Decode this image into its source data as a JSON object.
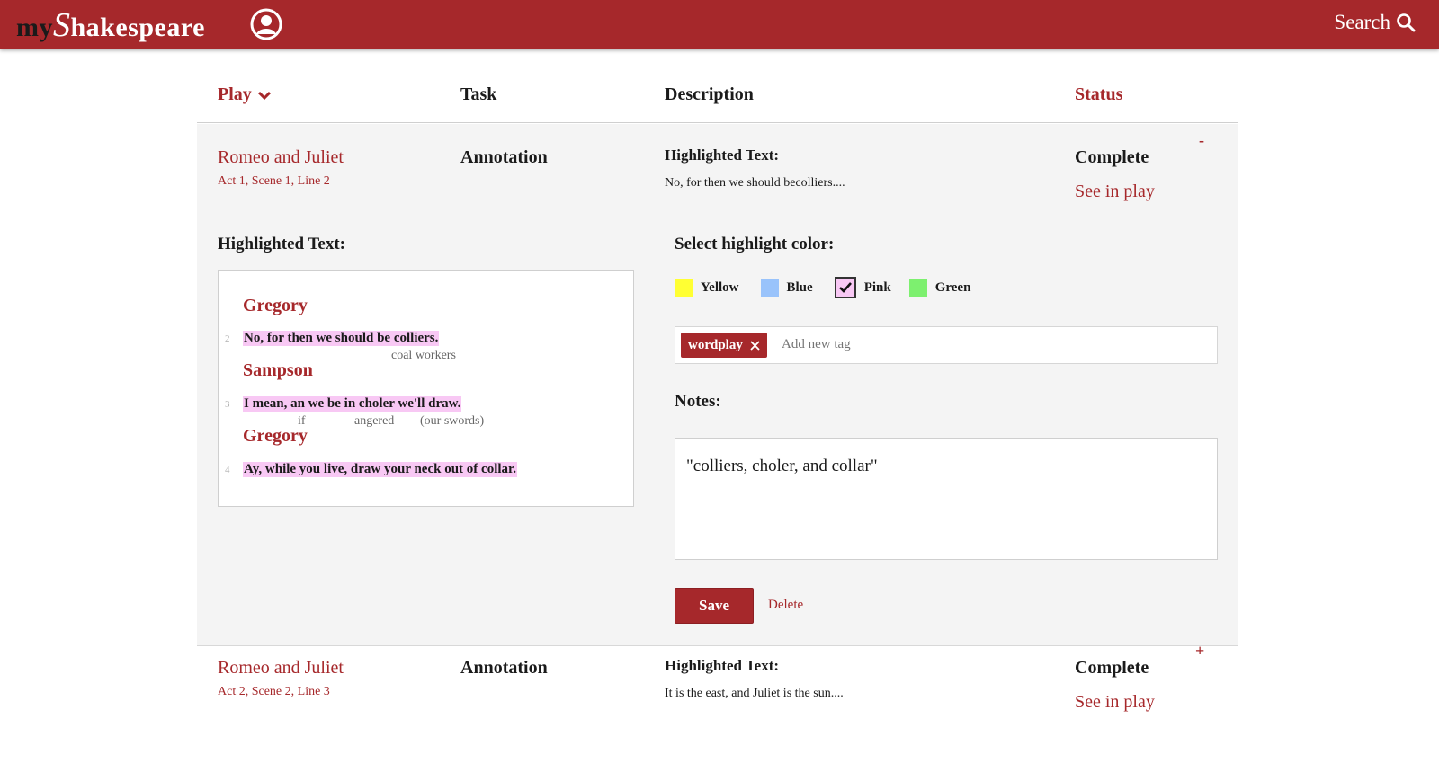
{
  "app": {
    "logo_prefix": "my",
    "logo_S": "S",
    "logo_rest": "hakespeare",
    "search_label": "Search"
  },
  "columns": {
    "play": "Play",
    "task": "Task",
    "description": "Description",
    "status": "Status"
  },
  "rows": [
    {
      "play": "Romeo and Juliet",
      "location": "Act 1, Scene 1, Line 2",
      "task": "Annotation",
      "desc_label": "Highlighted Text:",
      "desc_text": "No, for then we should becolliers....",
      "status": "Complete",
      "see_in_play": "See in play",
      "toggle": "-"
    },
    {
      "play": "Romeo and Juliet",
      "location": "Act 2, Scene 2, Line 3",
      "task": "Annotation",
      "desc_label": "Highlighted Text:",
      "desc_text": "It is the east, and Juliet is the sun....",
      "status": "Complete",
      "see_in_play": "See in play",
      "toggle": "+"
    }
  ],
  "editor": {
    "highlighted_label": "Highlighted Text:",
    "passage": {
      "speaker1": "Gregory",
      "n1": "2",
      "line1": "No, for then we should be colliers.",
      "gloss1": "coal workers",
      "speaker2": "Sampson",
      "n2": "3",
      "line2": "I mean, an we be in choler we'll draw.",
      "gloss2a": "if",
      "gloss2b": "angered",
      "gloss2c": "(our swords)",
      "speaker3": "Gregory",
      "n3": "4",
      "line3": "Ay, while you live, draw your neck out of collar."
    },
    "color_label": "Select highlight color:",
    "colors": [
      {
        "name": "Yellow",
        "hex": "#ffff33"
      },
      {
        "name": "Blue",
        "hex": "#99c3fb"
      },
      {
        "name": "Pink",
        "hex": "#f8c8f4",
        "selected": true
      },
      {
        "name": "Green",
        "hex": "#7df06f"
      }
    ],
    "tag": "wordplay",
    "tag_placeholder": "Add new tag",
    "notes_label": "Notes:",
    "notes_value": "\"colliers, choler, and collar\"",
    "save_label": "Save",
    "delete_label": "Delete"
  },
  "theme": {
    "brand": "#a6282b"
  }
}
